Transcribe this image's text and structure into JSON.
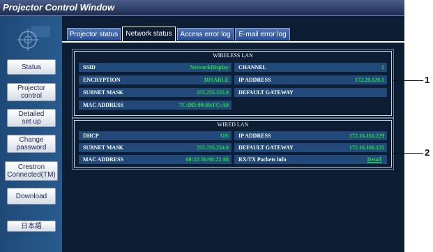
{
  "window": {
    "title": "Projector Control Window"
  },
  "sidebar": {
    "items": [
      {
        "label": "Status"
      },
      {
        "label": "Projector\ncontrol"
      },
      {
        "label": "Detailed\nset up"
      },
      {
        "label": "Change\npassword"
      },
      {
        "label": "Crestron\nConnected(TM)"
      },
      {
        "label": "Download"
      },
      {
        "label": "日本語"
      }
    ]
  },
  "tabs": [
    {
      "label": "Projector status"
    },
    {
      "label": "Network status",
      "active": true
    },
    {
      "label": "Access error log"
    },
    {
      "label": "E-mail error log"
    }
  ],
  "wireless": {
    "title": "WIRELESS LAN",
    "ssid": {
      "label": "SSID",
      "value": "NetworkDisplay"
    },
    "channel": {
      "label": "CHANNEL",
      "value": "1"
    },
    "encryption": {
      "label": "ENCRYPTION",
      "value": "DISABLE"
    },
    "ip": {
      "label": "IP ADDRESS",
      "value": "172.28.120.1"
    },
    "subnet": {
      "label": "SUBNET MASK",
      "value": "255.255.255.0"
    },
    "gateway": {
      "label": "DEFAULT GATEWAY",
      "value": ""
    },
    "mac": {
      "label": "MAC ADDRESS",
      "value": "7C:DD:90:60:FC:A0"
    }
  },
  "wired": {
    "title": "WIRED LAN",
    "dhcp": {
      "label": "DHCP",
      "value": "ON"
    },
    "ip": {
      "label": "IP ADDRESS",
      "value": "172.16.161.229"
    },
    "subnet": {
      "label": "SUBNET MASK",
      "value": "255.255.254.0"
    },
    "gateway": {
      "label": "DEFAULT GATEWAY",
      "value": "172.16.160.125"
    },
    "mac": {
      "label": "MAC ADDRESS",
      "value": "00:22:56:98:22:88"
    },
    "packets": {
      "label": "RX/TX Packets info",
      "value": "Detail"
    }
  },
  "callouts": {
    "one": "1",
    "two": "2"
  },
  "colors": {
    "value_green": "#22e03a",
    "panel_bg": "#0d1d33",
    "cell_bg": "#214a7a"
  }
}
